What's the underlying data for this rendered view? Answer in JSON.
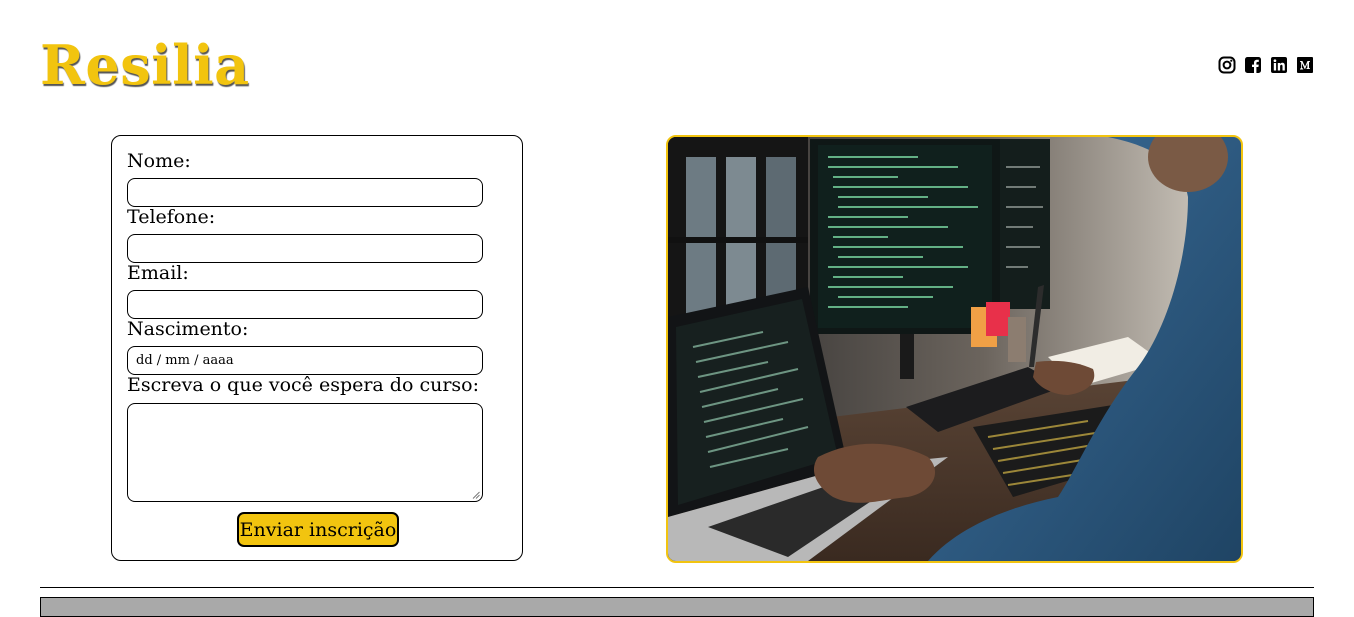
{
  "header": {
    "logo_text": "Resilia",
    "social_icons": [
      "instagram-icon",
      "facebook-icon",
      "linkedin-icon",
      "medium-icon"
    ]
  },
  "form": {
    "name_label": "Nome:",
    "name_value": "",
    "phone_label": "Telefone:",
    "phone_value": "",
    "email_label": "Email:",
    "email_value": "",
    "birth_label": "Nascimento:",
    "birth_placeholder": "dd / mm / aaaa",
    "expectation_label": "Escreva o que você espera do curso:",
    "expectation_value": "",
    "submit_label": "Enviar inscrição"
  },
  "colors": {
    "brand_yellow": "#f2c40f",
    "border": "#000000",
    "footer_gray": "#a9a9a9"
  }
}
